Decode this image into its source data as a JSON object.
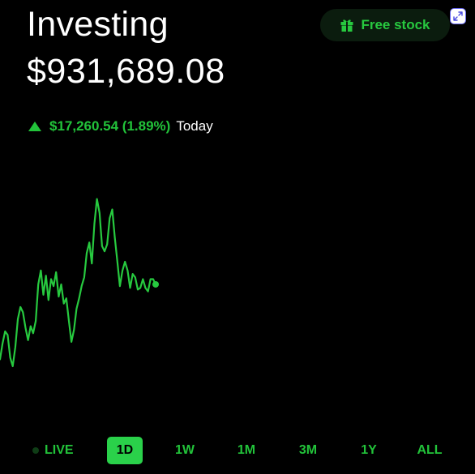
{
  "header": {
    "title": "Investing",
    "balance": "$931,689.08"
  },
  "change": {
    "value": "$17,260.54 (1.89%)",
    "period": "Today",
    "direction": "up"
  },
  "free_stock": {
    "label": "Free stock",
    "icon": "gift-icon"
  },
  "expand": {
    "icon": "expand-icon"
  },
  "colors": {
    "accent": "#22c33a",
    "line": "#27c93f",
    "background": "#000000",
    "text": "#ffffff"
  },
  "ranges": {
    "live": "LIVE",
    "d1": "1D",
    "w1": "1W",
    "m1": "1M",
    "m3": "3M",
    "y1": "1Y",
    "all": "ALL",
    "selected": "1D"
  },
  "chart_data": {
    "type": "line",
    "title": "",
    "xlabel": "",
    "ylabel": "",
    "ylim": [
      0,
      100
    ],
    "grid": false,
    "series": [
      {
        "values": [
          24,
          33,
          40,
          38,
          25,
          20,
          31,
          47,
          54,
          51,
          42,
          35,
          43,
          39,
          46,
          67,
          75,
          61,
          72,
          58,
          70,
          66,
          74,
          60,
          67,
          56,
          59,
          46,
          34,
          41,
          53,
          59,
          66,
          71,
          85,
          91,
          79,
          102,
          116,
          108,
          89,
          86,
          90,
          105,
          110,
          94,
          80,
          66,
          75,
          80,
          75,
          65,
          73,
          71,
          64,
          65,
          70,
          65,
          63,
          70,
          70,
          67
        ]
      }
    ]
  }
}
